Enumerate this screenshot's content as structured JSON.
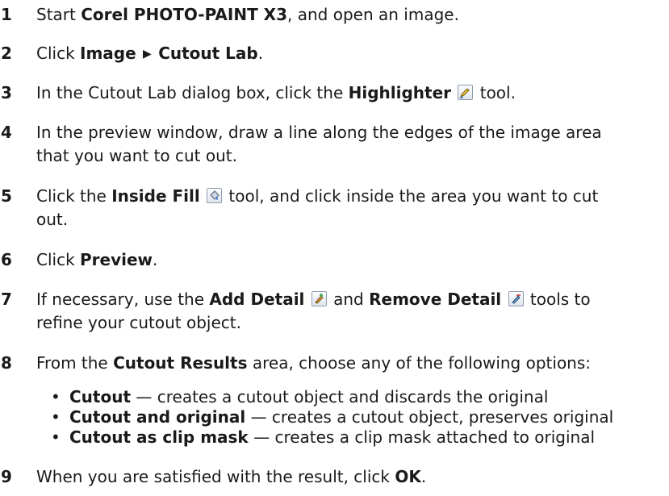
{
  "steps": [
    {
      "num": "1",
      "pre": "Start ",
      "b1": "Corel PHOTO-PAINT X3",
      "post": ", and open an image."
    },
    {
      "num": "2",
      "pre": "Click ",
      "b1": "Image",
      "b2": "Cutout Lab",
      "post": "."
    },
    {
      "num": "3",
      "pre": "In the Cutout Lab dialog box, click the ",
      "b1": "Highlighter",
      "post": " tool."
    },
    {
      "num": "4",
      "line1": "In the preview window, draw a line along the edges of the image area",
      "line2": "that you want to cut out."
    },
    {
      "num": "5",
      "pre": "Click the ",
      "b1": "Inside Fill",
      "post": " tool, and click inside the area you want to cut",
      "line2": "out."
    },
    {
      "num": "6",
      "pre": "Click ",
      "b1": "Preview",
      "post": "."
    },
    {
      "num": "7",
      "pre": "If necessary, use the ",
      "b1": "Add Detail",
      "mid": " and ",
      "b2": "Remove Detail",
      "post": " tools to",
      "line2": "refine your cutout object."
    },
    {
      "num": "8",
      "pre": "From the ",
      "b1": "Cutout Results",
      "post": " area, choose any of the following options:"
    },
    {
      "num": "9",
      "pre": "When you are satisfied with the result, click ",
      "b1": "OK",
      "post": "."
    }
  ],
  "options": [
    {
      "bullet": "•",
      "label": "Cutout",
      "desc": " — creates a cutout object and discards the original"
    },
    {
      "bullet": "•",
      "label": "Cutout and original",
      "desc": " — creates a cutout object, preserves original"
    },
    {
      "bullet": "•",
      "label": "Cutout as clip mask",
      "desc": " — creates a clip mask attached to original"
    }
  ],
  "menu_arrow": "▶",
  "icons": {
    "highlighter": "highlighter-icon",
    "inside_fill": "inside-fill-icon",
    "add_detail": "add-detail-icon",
    "remove_detail": "remove-detail-icon"
  }
}
